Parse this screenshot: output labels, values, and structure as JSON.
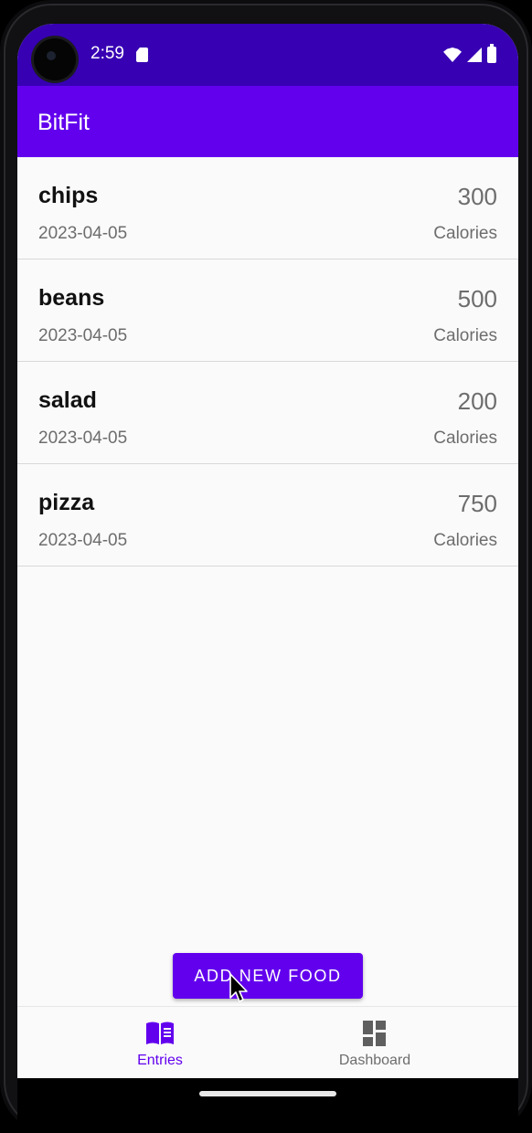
{
  "status_bar": {
    "time": "2:59",
    "icons": [
      "sd-card-icon",
      "wifi-icon",
      "signal-icon",
      "battery-icon"
    ]
  },
  "app_bar": {
    "title": "BitFit"
  },
  "entries": [
    {
      "name": "chips",
      "date": "2023-04-05",
      "calories": "300",
      "unit": "Calories"
    },
    {
      "name": "beans",
      "date": "2023-04-05",
      "calories": "500",
      "unit": "Calories"
    },
    {
      "name": "salad",
      "date": "2023-04-05",
      "calories": "200",
      "unit": "Calories"
    },
    {
      "name": "pizza",
      "date": "2023-04-05",
      "calories": "750",
      "unit": "Calories"
    }
  ],
  "add_button": {
    "label": "ADD NEW FOOD"
  },
  "bottom_nav": {
    "items": [
      {
        "label": "Entries",
        "icon": "book-icon",
        "selected": true
      },
      {
        "label": "Dashboard",
        "icon": "dashboard-icon",
        "selected": false
      }
    ]
  },
  "colors": {
    "primary": "#6200ee",
    "primary_dark": "#3700b3",
    "background": "#fafafa",
    "secondary_text": "#6d6d6d"
  }
}
